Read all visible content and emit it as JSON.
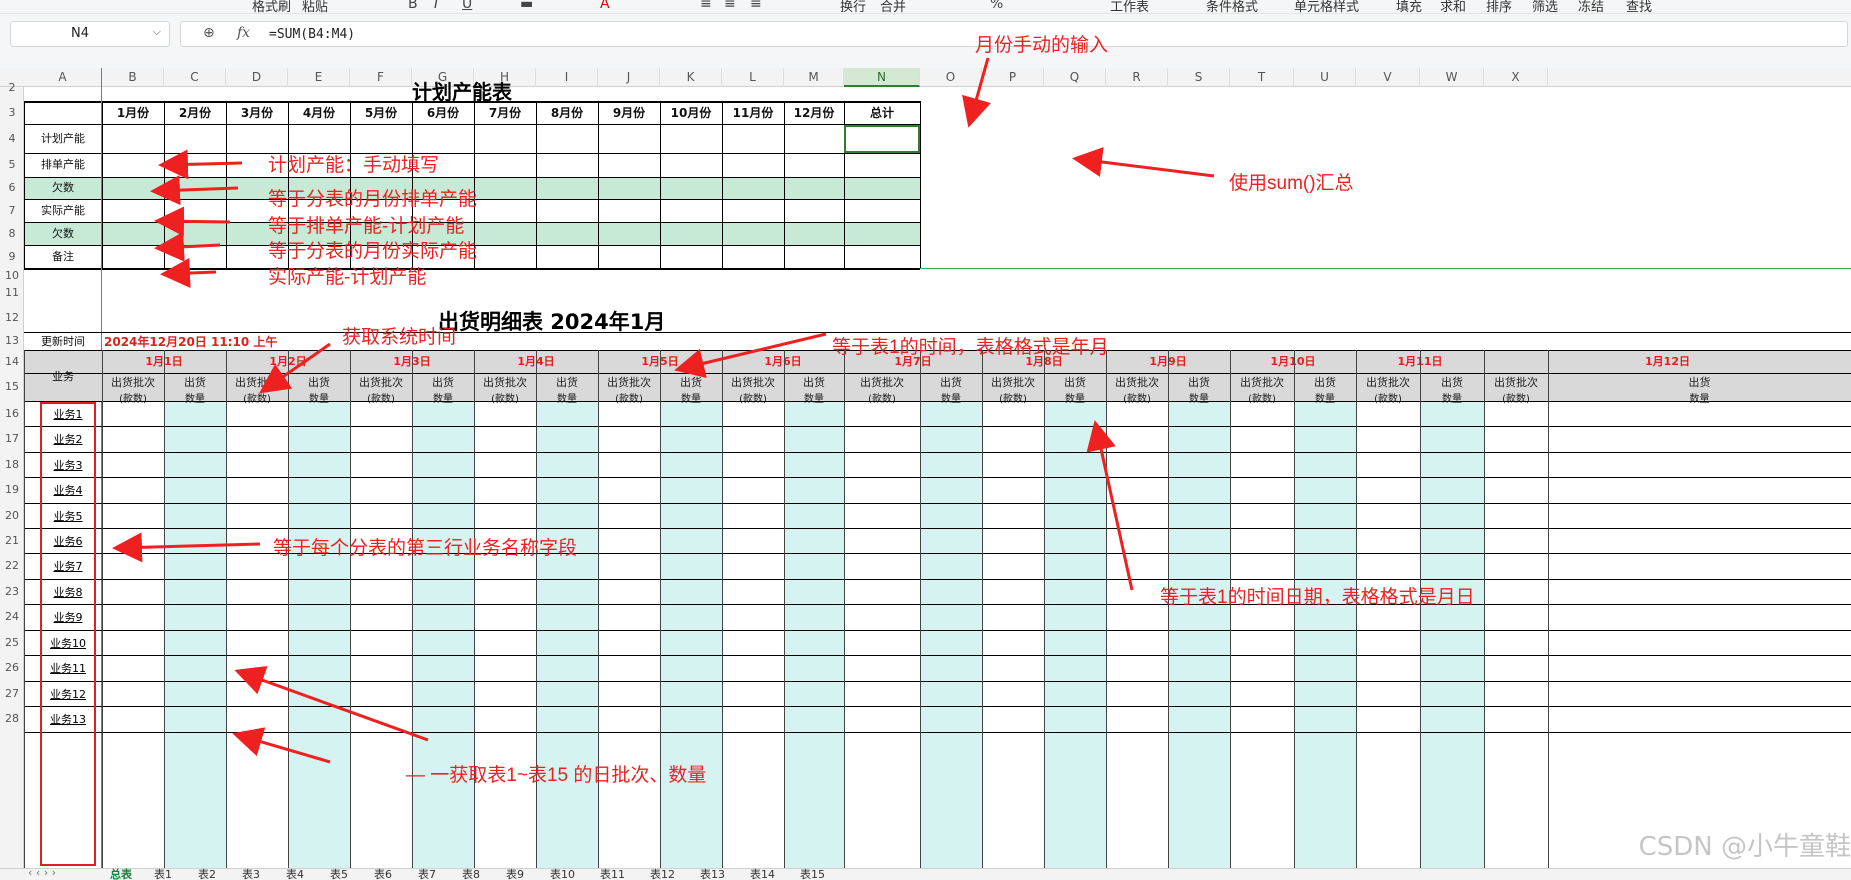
{
  "ribbon": {
    "items": [
      "格式刷",
      "粘贴",
      "换行",
      "合并",
      "工作表",
      "条件格式",
      "单元格样式",
      "填充",
      "求和",
      "排序",
      "筛选",
      "冻结",
      "查找"
    ]
  },
  "formula_bar": {
    "cell_ref": "N4",
    "fx": "fx",
    "formula": "=SUM(B4:M4)"
  },
  "columns": [
    "A",
    "B",
    "C",
    "D",
    "E",
    "F",
    "G",
    "H",
    "I",
    "J",
    "K",
    "L",
    "M",
    "N",
    "O",
    "P",
    "Q",
    "R",
    "S",
    "T",
    "U",
    "V",
    "W",
    "X"
  ],
  "active_column": "N",
  "rows": [
    "2",
    "3",
    "4",
    "5",
    "6",
    "7",
    "8",
    "9",
    "10",
    "11",
    "12",
    "13",
    "14",
    "15",
    "16",
    "17",
    "18",
    "19",
    "20",
    "21",
    "22",
    "23",
    "24",
    "25",
    "26",
    "27",
    "28"
  ],
  "plan_table": {
    "title": "计划产能表",
    "months": [
      "1月份",
      "2月份",
      "3月份",
      "4月份",
      "5月份",
      "6月份",
      "7月份",
      "8月份",
      "9月份",
      "10月份",
      "11月份",
      "12月份",
      "总计"
    ],
    "row_labels": [
      "计划产能",
      "排单产能",
      "欠数",
      "实际产能",
      "欠数",
      "备注"
    ]
  },
  "detail_table": {
    "title": "出货明细表 2024年1月",
    "update_label": "更新时间",
    "update_value": "2024年12月20日 11:10 上午",
    "biz_header": "业务",
    "days": [
      "1月1日",
      "1月2日",
      "1月3日",
      "1月4日",
      "1月5日",
      "1月6日",
      "1月7日",
      "1月8日",
      "1月9日",
      "1月10日",
      "1月11日",
      "1月12日"
    ],
    "sub_batch": "出货批次",
    "sub_batch_unit": "(款数)",
    "sub_qty": "出货",
    "sub_qty_unit": "数量",
    "businesses": [
      "业务1",
      "业务2",
      "业务3",
      "业务4",
      "业务5",
      "业务6",
      "业务7",
      "业务8",
      "业务9",
      "业务10",
      "业务11",
      "业务12",
      "业务13"
    ]
  },
  "annotations": {
    "a1": "月份手动的输入",
    "a2": "计划产能：手动填写",
    "a3": "等于分表的月份排单产能",
    "a4": "等于排单产能-计划产能",
    "a5": "等于分表的月份实际产能",
    "a6": "实际产能-计划产能",
    "a7": "使用sum()汇总",
    "a8": "获取系统时间",
    "a9": "等于表1的时间，表格格式是年月",
    "a10": "等于每个分表的第三行业务名称字段",
    "a11": "等于表1的时间日期，表格格式是月日",
    "a12": "— 一获取表1~表15 的日批次、数量"
  },
  "sheet_tabs": [
    "总表",
    "表1",
    "表2",
    "表3",
    "表4",
    "表5",
    "表6",
    "表7",
    "表8",
    "表9",
    "表10",
    "表11",
    "表12",
    "表13",
    "表14",
    "表15"
  ],
  "active_tab": "总表",
  "watermark": "CSDN @小牛童鞋",
  "colors": {
    "accent_green": "#2e7d32",
    "annotation_red": "#ef2020",
    "fill_green": "#c6ead6",
    "fill_cyan": "#d5f3f1"
  }
}
